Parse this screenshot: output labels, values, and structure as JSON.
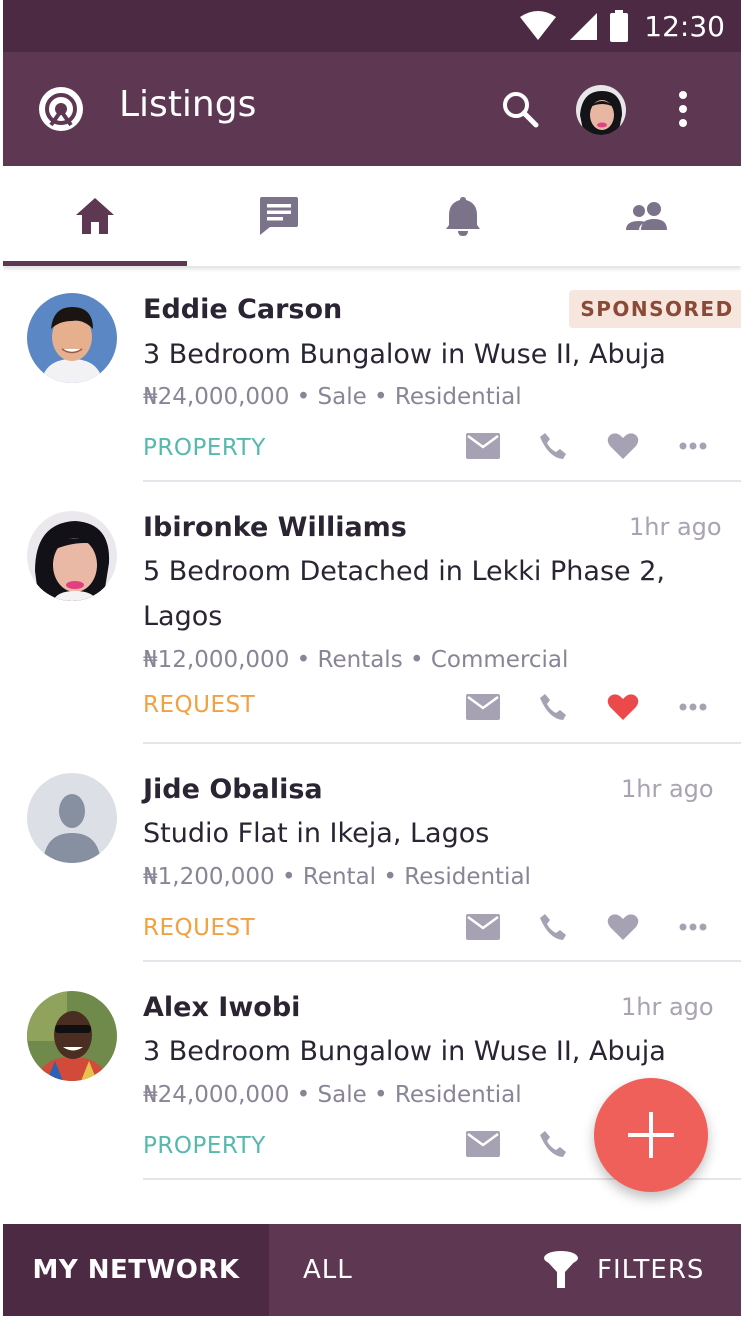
{
  "status_bar": {
    "time": "12:30"
  },
  "app_bar": {
    "title": "Listings"
  },
  "tabs": [
    {
      "icon": "home-icon",
      "active": true
    },
    {
      "icon": "message-icon",
      "active": false
    },
    {
      "icon": "bell-icon",
      "active": false
    },
    {
      "icon": "people-icon",
      "active": false
    }
  ],
  "listings": [
    {
      "name": "Eddie Carson",
      "badge": "SPONSORED",
      "title": "3 Bedroom Bungalow in Wuse II, Abuja",
      "meta": "₦24,000,000 • Sale • Residential",
      "tag": "PROPERTY",
      "liked": false
    },
    {
      "name": "Ibironke Williams",
      "time": "1hr ago",
      "title": "5 Bedroom Detached in Lekki Phase 2, Lagos",
      "meta": "₦12,000,000 • Rentals • Commercial",
      "tag": "REQUEST",
      "liked": true
    },
    {
      "name": "Jide Obalisa",
      "time": "1hr ago",
      "title": "Studio Flat in Ikeja, Lagos",
      "meta": "₦1,200,000 • Rental • Residential",
      "tag": "REQUEST",
      "liked": false
    },
    {
      "name": "Alex Iwobi",
      "time": "1hr ago",
      "title": "3 Bedroom Bungalow in Wuse II, Abuja",
      "meta": "₦24,000,000 • Sale • Residential",
      "tag": "PROPERTY",
      "liked": false
    }
  ],
  "bottom_bar": {
    "my_network": "MY NETWORK",
    "all": "ALL",
    "filters": "FILTERS"
  },
  "colors": {
    "primary": "#5e3753",
    "primary_dark": "#4d2a44",
    "accent": "#f0605a",
    "property": "#55b9ad",
    "request": "#f2a041",
    "liked": "#ec4a4a"
  }
}
